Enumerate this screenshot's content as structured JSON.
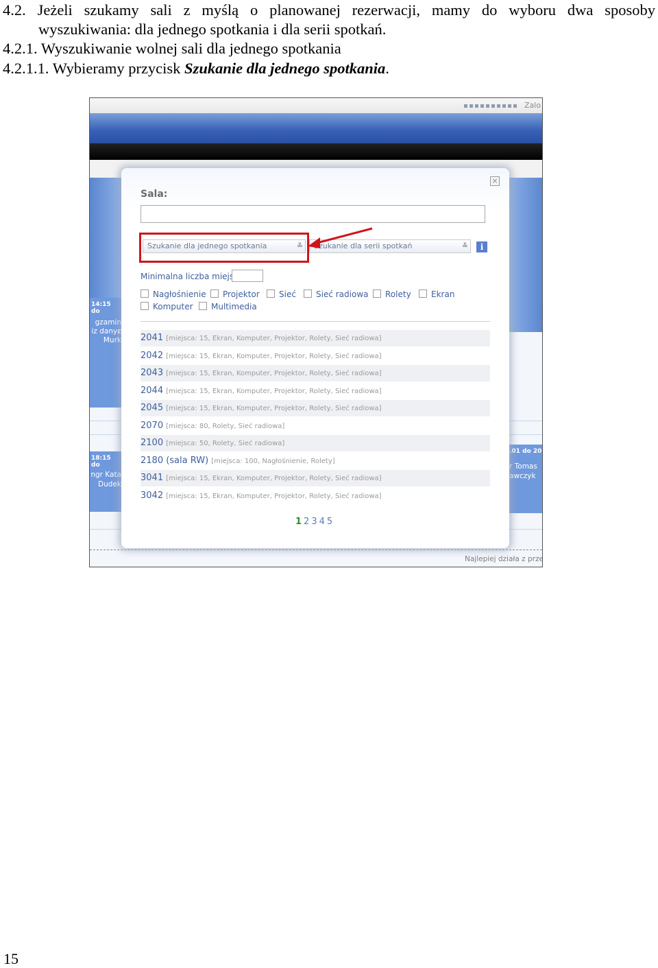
{
  "document": {
    "line1_words": [
      "4.2.",
      "Jeżeli",
      "szukamy",
      "sali",
      "z",
      "myślą",
      "o",
      "planowanej",
      "rezerwacji,",
      "mamy",
      "do",
      "wyboru",
      "dwa",
      "sposoby"
    ],
    "line2": "wyszukiwania: dla jednego spotkania i dla serii spotkań.",
    "line3": "4.2.1. Wyszukiwanie wolnej sali dla jednego spotkania",
    "line4_prefix": "4.2.1.1. Wybieramy przycisk ",
    "line4_emphasis": "Szukanie dla jednego spotkania",
    "line4_suffix": ".",
    "page_number": "15"
  },
  "screenshot": {
    "header_link": "Zalo",
    "footer_note": "Najlepiej działa z prze",
    "calendar_left": {
      "time1": "14:15 do",
      "event1": [
        "gzamin z",
        "iz danyc",
        "Murk"
      ],
      "time2": "18:15 do",
      "event2": [
        "ngr Kata",
        "Dudek"
      ]
    },
    "calendar_right": {
      "time": ".01 do 20",
      "event": [
        "r Tomas",
        "awczyk"
      ]
    },
    "modal": {
      "room_label": "Sala:",
      "room_input_value": "",
      "search_single_label": "Szukanie dla jednego spotkania",
      "search_series_label": "Szukanie dla serii spotkań",
      "info_icon": "i",
      "close_icon": "×",
      "min_seats_label": "Minimalna liczba miejsc:",
      "min_seats_value": "",
      "options": [
        "Nagłośnienie",
        "Projektor",
        "Sieć",
        "Sieć radiowa",
        "Rolety",
        "Ekran",
        "Komputer",
        "Multimedia"
      ],
      "rooms": [
        {
          "name": "2041",
          "details": "[miejsca: 15, Ekran, Komputer, Projektor, Rolety, Sieć radiowa]"
        },
        {
          "name": "2042",
          "details": "[miejsca: 15, Ekran, Komputer, Projektor, Rolety, Sieć radiowa]"
        },
        {
          "name": "2043",
          "details": "[miejsca: 15, Ekran, Komputer, Projektor, Rolety, Sieć radiowa]"
        },
        {
          "name": "2044",
          "details": "[miejsca: 15, Ekran, Komputer, Projektor, Rolety, Sieć radiowa]"
        },
        {
          "name": "2045",
          "details": "[miejsca: 15, Ekran, Komputer, Projektor, Rolety, Sieć radiowa]"
        },
        {
          "name": "2070",
          "details": "[miejsca: 80, Rolety, Sieć radiowa]"
        },
        {
          "name": "2100",
          "details": "[miejsca: 50, Rolety, Sieć radiowa]"
        },
        {
          "name": "2180 (sala RW)",
          "details": "[miejsca: 100, Nagłośnienie, Rolety]"
        },
        {
          "name": "3041",
          "details": "[miejsca: 15, Ekran, Komputer, Projektor, Rolety, Sieć radiowa]"
        },
        {
          "name": "3042",
          "details": "[miejsca: 15, Ekran, Komputer, Projektor, Rolety, Sieć radiowa]"
        }
      ],
      "pages": [
        "1",
        "2",
        "3",
        "4",
        "5"
      ],
      "current_page": "1"
    },
    "colors": {
      "highlight_red": "#d0141b",
      "link_blue": "#3f5f9d",
      "header_blue": "#3a63b8"
    }
  }
}
